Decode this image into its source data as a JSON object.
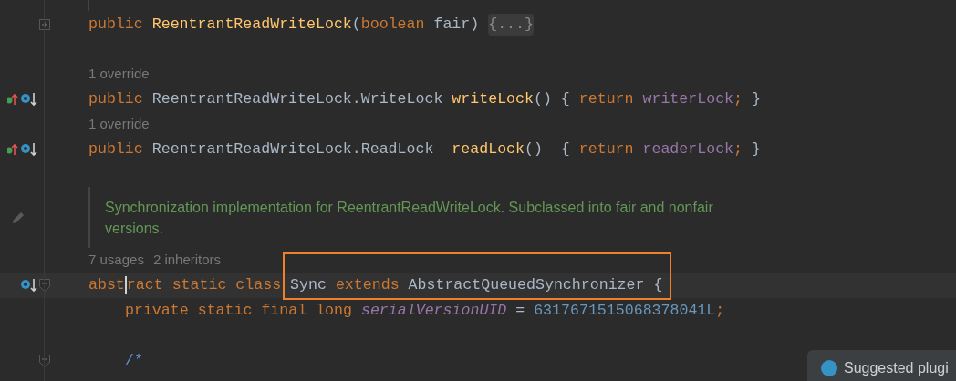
{
  "lines": [
    {
      "kind": "code",
      "fold_collapsed": true,
      "tokens": [
        {
          "text": "public ",
          "kind": "keyword"
        },
        {
          "text": "ReentrantReadWriteLock",
          "kind": "method"
        },
        {
          "text": "(",
          "kind": "plain"
        },
        {
          "text": "boolean ",
          "kind": "keyword"
        },
        {
          "text": "fair",
          "kind": "plain"
        },
        {
          "text": ") ",
          "kind": "plain"
        },
        {
          "text": "{...}",
          "kind": "folded"
        }
      ]
    },
    {
      "kind": "blank"
    },
    {
      "kind": "hint",
      "hints": [
        "1 override"
      ]
    },
    {
      "kind": "code",
      "overriding": true,
      "implemented": true,
      "tokens": [
        {
          "text": "public ",
          "kind": "keyword"
        },
        {
          "text": "ReentrantReadWriteLock.WriteLock ",
          "kind": "plain"
        },
        {
          "text": "writeLock",
          "kind": "method"
        },
        {
          "text": "() { ",
          "kind": "plain"
        },
        {
          "text": "return ",
          "kind": "keyword"
        },
        {
          "text": "writerLock",
          "kind": "field"
        },
        {
          "text": "; ",
          "kind": "keyword"
        },
        {
          "text": "}",
          "kind": "plain"
        }
      ]
    },
    {
      "kind": "hint",
      "hints": [
        "1 override"
      ]
    },
    {
      "kind": "code",
      "overriding": true,
      "implemented": true,
      "tokens": [
        {
          "text": "public ",
          "kind": "keyword"
        },
        {
          "text": "ReentrantReadWriteLock.ReadLock  ",
          "kind": "plain"
        },
        {
          "text": "readLock",
          "kind": "method"
        },
        {
          "text": "()  { ",
          "kind": "plain"
        },
        {
          "text": "return ",
          "kind": "keyword"
        },
        {
          "text": "readerLock",
          "kind": "field"
        },
        {
          "text": "; ",
          "kind": "keyword"
        },
        {
          "text": "}",
          "kind": "plain"
        }
      ]
    },
    {
      "kind": "blank"
    },
    {
      "kind": "doc",
      "text": "Synchronization implementation for ReentrantReadWriteLock. Subclassed into fair and nonfair versions."
    },
    {
      "kind": "hint",
      "hints": [
        "7 usages",
        "2 inheritors"
      ]
    },
    {
      "kind": "code",
      "fold_expanded": true,
      "implemented": true,
      "current": true,
      "tokens": [
        {
          "text": "abst",
          "kind": "keyword",
          "caret_after": true
        },
        {
          "text": "ract ",
          "kind": "keyword"
        },
        {
          "text": "static ",
          "kind": "keyword"
        },
        {
          "text": "class ",
          "kind": "keyword"
        },
        {
          "text": "Sync ",
          "kind": "plain",
          "boxed": true
        },
        {
          "text": "extends ",
          "kind": "keyword",
          "boxed": true
        },
        {
          "text": "AbstractQueuedSynchronizer {",
          "kind": "plain",
          "boxed": true
        }
      ]
    },
    {
      "kind": "code",
      "indented": true,
      "tokens": [
        {
          "text": "private ",
          "kind": "keyword"
        },
        {
          "text": "static ",
          "kind": "keyword"
        },
        {
          "text": "final ",
          "kind": "keyword"
        },
        {
          "text": "long ",
          "kind": "keyword"
        },
        {
          "text": "serialVersionUID",
          "kind": "constant"
        },
        {
          "text": " = ",
          "kind": "plain"
        },
        {
          "text": "6317671515068378041L",
          "kind": "number"
        },
        {
          "text": ";",
          "kind": "keyword"
        }
      ]
    },
    {
      "kind": "blank"
    },
    {
      "kind": "code",
      "fold_expanded": true,
      "indented": true,
      "tokens": [
        {
          "text": "/*",
          "kind": "comment"
        }
      ]
    }
  ],
  "notification": {
    "text": "Suggested plugi"
  }
}
